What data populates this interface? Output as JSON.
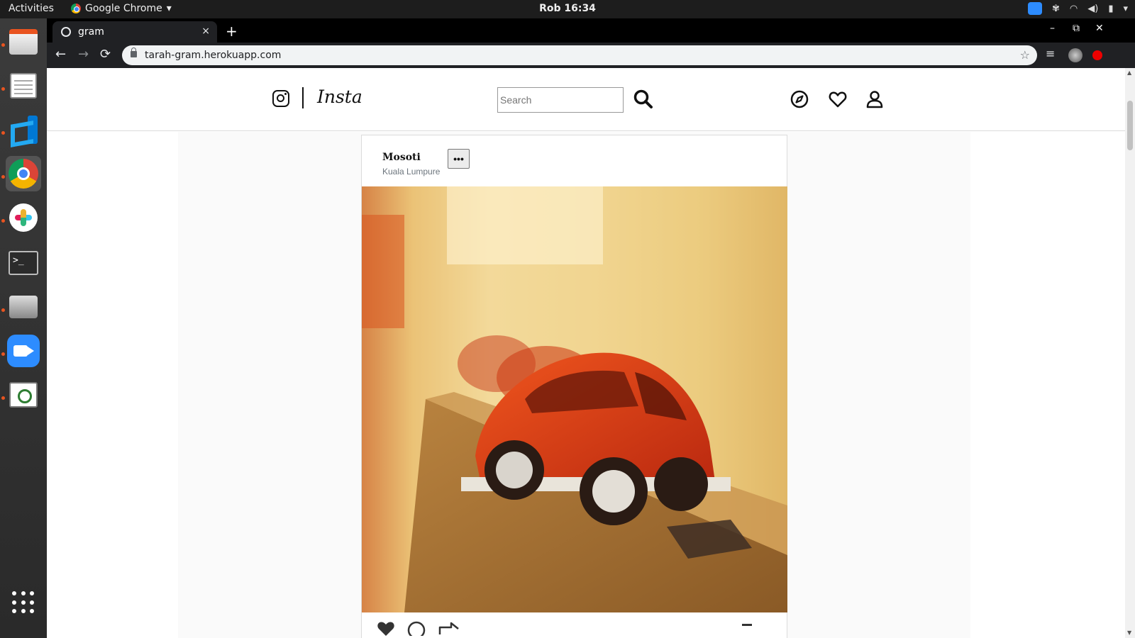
{
  "system": {
    "activities": "Activities",
    "app_menu": "Google Chrome",
    "clock": "Rob 16:34"
  },
  "browser": {
    "tab_title": "gram",
    "tab_close": "×",
    "new_tab": "+",
    "url": "tarah-gram.herokuapp.com",
    "back": "←",
    "forward": "→",
    "reload": "⟳",
    "bookmark": "☆",
    "minimize": "–",
    "maximize": "⧉",
    "close": "✕"
  },
  "navbar": {
    "brand": "Insta",
    "search_placeholder": "Search"
  },
  "post": {
    "username": "Mosoti",
    "location": "Kuala Lumpure",
    "more": "•••"
  },
  "colors": {
    "chrome_dark": "#202124",
    "topbar": "#1d1d1d",
    "dock": "#3b3b3b",
    "accent_orange": "#e95420",
    "zoom_blue": "#2d8cff",
    "border": "#dbdbdb"
  },
  "icons": {
    "dock": [
      "files-icon",
      "text-editor-icon",
      "vscode-icon",
      "chrome-icon",
      "slack-icon",
      "terminal-icon",
      "scanner-icon",
      "zoom-icon",
      "image-viewer-icon",
      "show-apps-icon"
    ],
    "navbar": [
      "instagram-icon",
      "search-icon",
      "compass-icon",
      "heart-icon",
      "user-icon"
    ]
  }
}
